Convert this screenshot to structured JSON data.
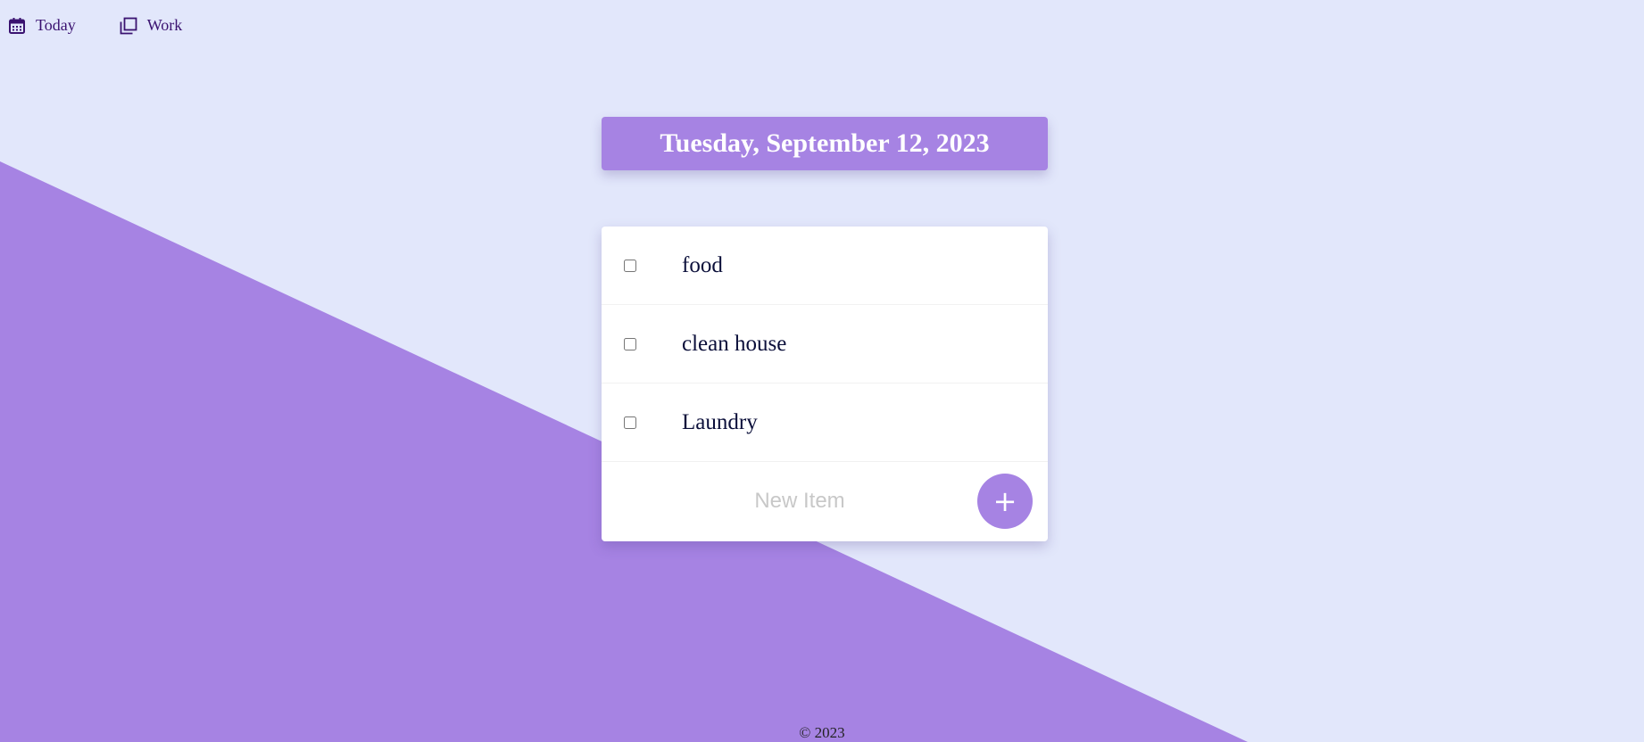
{
  "nav": {
    "items": [
      {
        "label": "Today",
        "icon": "calendar-icon"
      },
      {
        "label": "Work",
        "icon": "copy-icon"
      }
    ]
  },
  "header": {
    "date": "Tuesday, September 12, 2023"
  },
  "todo": {
    "items": [
      {
        "text": "food",
        "checked": false
      },
      {
        "text": "clean house",
        "checked": false
      },
      {
        "text": "Laundry",
        "checked": false
      }
    ],
    "new_item": {
      "value": "",
      "placeholder": "New Item"
    },
    "add_label": "+"
  },
  "footer": {
    "text": "© 2023"
  },
  "colors": {
    "background": "#e2e7fb",
    "accent": "#a683e3",
    "nav_text": "#3a1270",
    "item_text": "#0b0f3a"
  }
}
